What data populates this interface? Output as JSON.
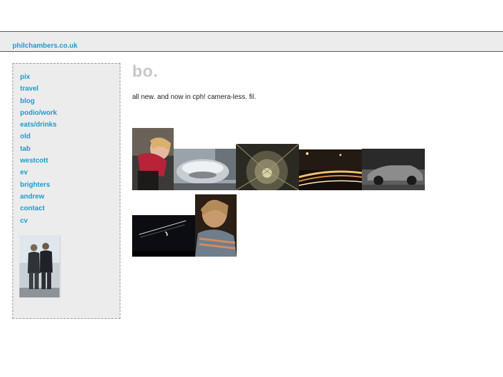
{
  "header": {
    "site_name": "philchambers.co.uk"
  },
  "sidebar": {
    "nav_items": [
      {
        "label": "pix"
      },
      {
        "label": "travel"
      },
      {
        "label": "blog"
      },
      {
        "label": "podio/work"
      },
      {
        "label": "eats/drinks"
      },
      {
        "label": "old"
      },
      {
        "label": "tab"
      },
      {
        "label": "westcott"
      },
      {
        "label": "ev"
      },
      {
        "label": "brighters"
      },
      {
        "label": "andrew"
      },
      {
        "label": "contact"
      },
      {
        "label": "cv"
      }
    ],
    "photo_icon": "portrait-photo-icon"
  },
  "main": {
    "title": "bo.",
    "intro": "all new. and now in cph! camera-less. fil."
  },
  "colors": {
    "link": "#1a9ccf",
    "title": "#c8c8c8",
    "panel_bg": "#ececec"
  }
}
